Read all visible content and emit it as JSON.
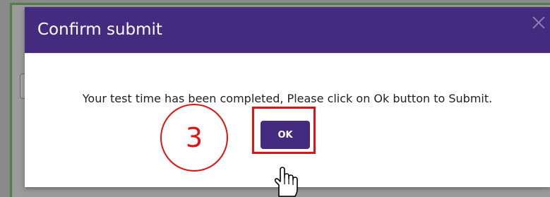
{
  "dialog": {
    "title": "Confirm submit",
    "message": "Your test time has been completed, Please click on Ok button to Submit.",
    "ok_label": "OK",
    "close_icon": "close-icon"
  },
  "annotation": {
    "step_number": "3",
    "highlight_color": "#e01212"
  },
  "colors": {
    "header": "#452b7f",
    "ok_button": "#452b7f",
    "backdrop": "#9b9b9b"
  },
  "cursor": "hand-pointer-icon"
}
